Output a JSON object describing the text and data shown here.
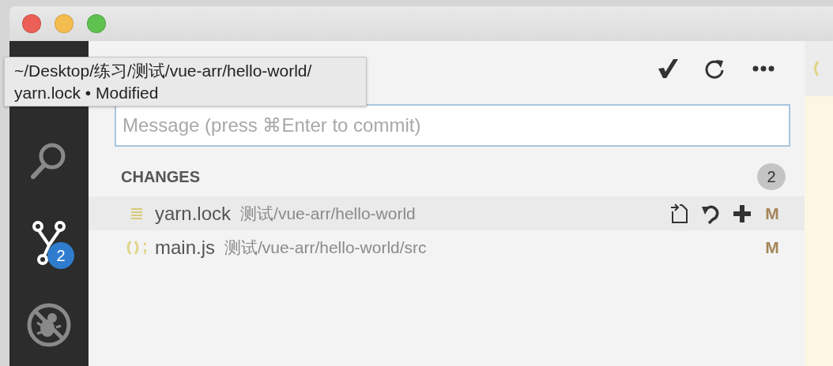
{
  "tooltip": {
    "lines": [
      "~/Desktop/练习/测试/vue-arr/hello-world/",
      "yarn.lock • Modified"
    ]
  },
  "activity_bar": {
    "items": [
      {
        "kind": "search",
        "selected": false
      },
      {
        "kind": "source-control",
        "selected": true,
        "badge": "2"
      },
      {
        "kind": "debug",
        "selected": false
      }
    ]
  },
  "commit_message": {
    "placeholder": "Message (press ⌘Enter to commit)"
  },
  "changes": {
    "title": "CHANGES",
    "count": "2",
    "files": [
      {
        "kind": "text",
        "name": "yarn.lock",
        "path": "测试/vue-arr/hello-world",
        "status": "M",
        "selected": true
      },
      {
        "kind": "script",
        "name": "main.js",
        "path": "测试/vue-arr/hello-world/src",
        "status": "M",
        "selected": false
      }
    ]
  }
}
